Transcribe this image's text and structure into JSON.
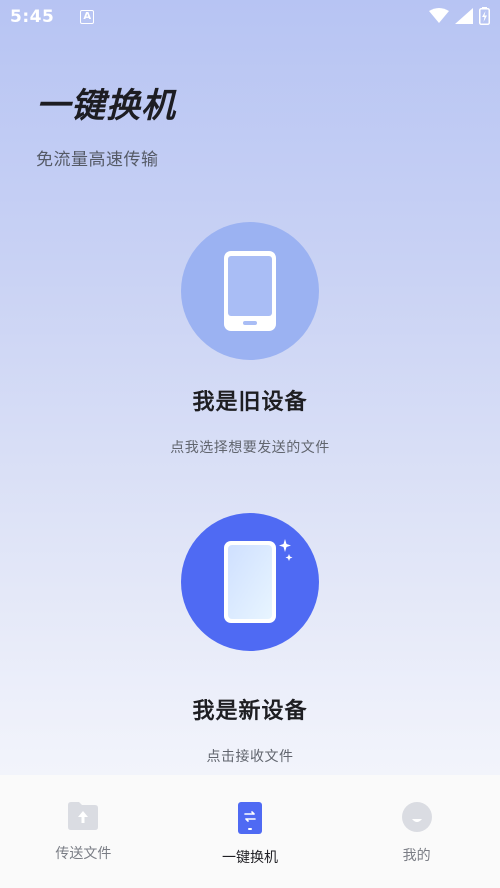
{
  "status_bar": {
    "time": "5:45",
    "notif_badge": "A"
  },
  "header": {
    "title": "一键换机",
    "subtitle": "免流量高速传输"
  },
  "old_device": {
    "title": "我是旧设备",
    "description": "点我选择想要发送的文件",
    "icon": "phone-icon"
  },
  "new_device": {
    "title": "我是新设备",
    "description": "点击接收文件",
    "icon": "phone-sparkle-icon"
  },
  "bottom_nav": {
    "items": [
      {
        "label": "传送文件",
        "icon": "folder-upload-icon",
        "active": false
      },
      {
        "label": "一键换机",
        "icon": "phone-transfer-icon",
        "active": true
      },
      {
        "label": "我的",
        "icon": "profile-icon",
        "active": false
      }
    ]
  },
  "colors": {
    "old_circle": "#9bb2f2",
    "new_circle": "#4f6af3",
    "accent": "#4f6af3"
  }
}
